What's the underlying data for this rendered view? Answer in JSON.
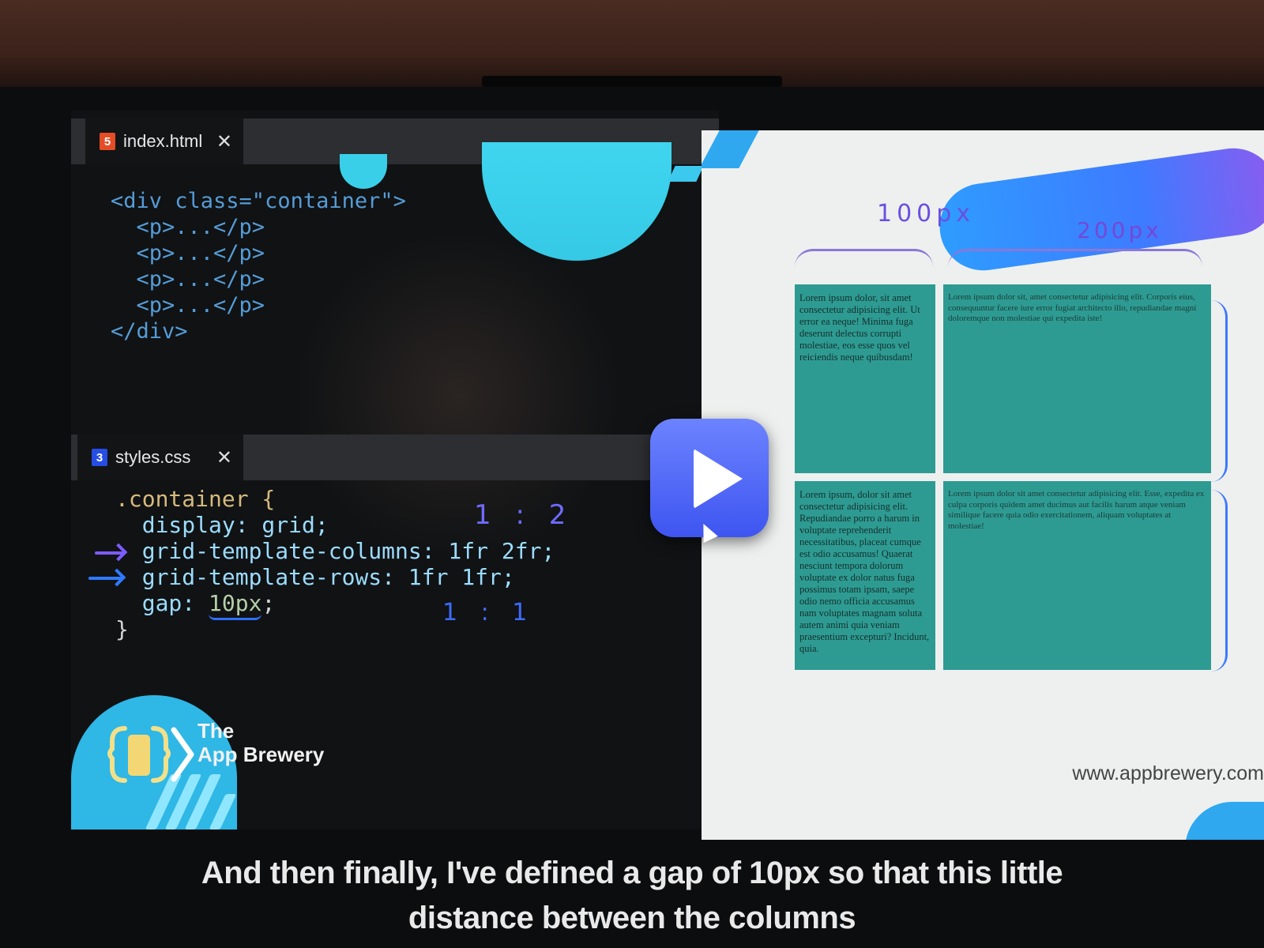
{
  "editor": {
    "html_tab": {
      "icon": "5",
      "label": "index.html",
      "close": "✕"
    },
    "css_tab": {
      "icon": "3",
      "label": "styles.css",
      "close": "✕"
    },
    "html_lines": [
      "<div class=\"container\">",
      "  <p>...</p>",
      "  <p>...</p>",
      "  <p>...</p>",
      "  <p>...</p>",
      "</div>"
    ],
    "css_lines": {
      "selector": ".container {",
      "display": "  display: grid;",
      "columns": "  grid-template-columns: 1fr 2fr;",
      "rows": "  grid-template-rows: 1fr 1fr;",
      "gap_prefix": "  gap: ",
      "gap_value": "10px",
      "gap_suffix": ";",
      "close": "}"
    },
    "annotations": {
      "columns_ratio": "1 : 2",
      "rows_ratio": "1 : 1"
    }
  },
  "brand": {
    "line1": "The",
    "line2": "App Brewery"
  },
  "preview": {
    "label_left": "100px",
    "label_right": "200px",
    "cells": [
      "Lorem ipsum dolor, sit amet consectetur adipisicing elit. Ut error ea neque! Minima fuga deserunt delectus corrupti molestiae, eos esse quos vel reiciendis neque quibusdam!",
      "Lorem ipsum dolor sit, amet consectetur adipisicing elit. Corporis eius, consequuntur facere iure error fugiat architecto illo, repudiandae magni doloremque non molestiae qui expedita iste!",
      "Lorem ipsum, dolor sit amet consectetur adipisicing elit. Repudiandae porro a harum in voluptate reprehenderit necessitatibus, placeat cumque est odio accusamus! Quaerat nesciunt tempora dolorum voluptate ex dolor natus fuga possimus totam ipsam, saepe odio nemo officia accusamus nam voluptates magnam soluta autem animi quia veniam praesentium excepturi? Incidunt, quia.",
      "Lorem ipsum dolor sit amet consectetur adipisicing elit. Esse, expedita ex culpa corporis quidem amet ducimus aut facilis harum atque veniam similique facere quia odio exercitationem, aliquam voluptates at molestiae!"
    ],
    "url": "www.appbrewery.com"
  },
  "caption": {
    "line1": "And then finally, I've defined a gap of 10px so that this little",
    "line2": "distance between the columns"
  },
  "colors": {
    "accent_blue": "#3e55f0",
    "cell_teal": "#2e9b92",
    "hand_violet": "#b06bff",
    "hand_blue": "#3d6bff"
  }
}
